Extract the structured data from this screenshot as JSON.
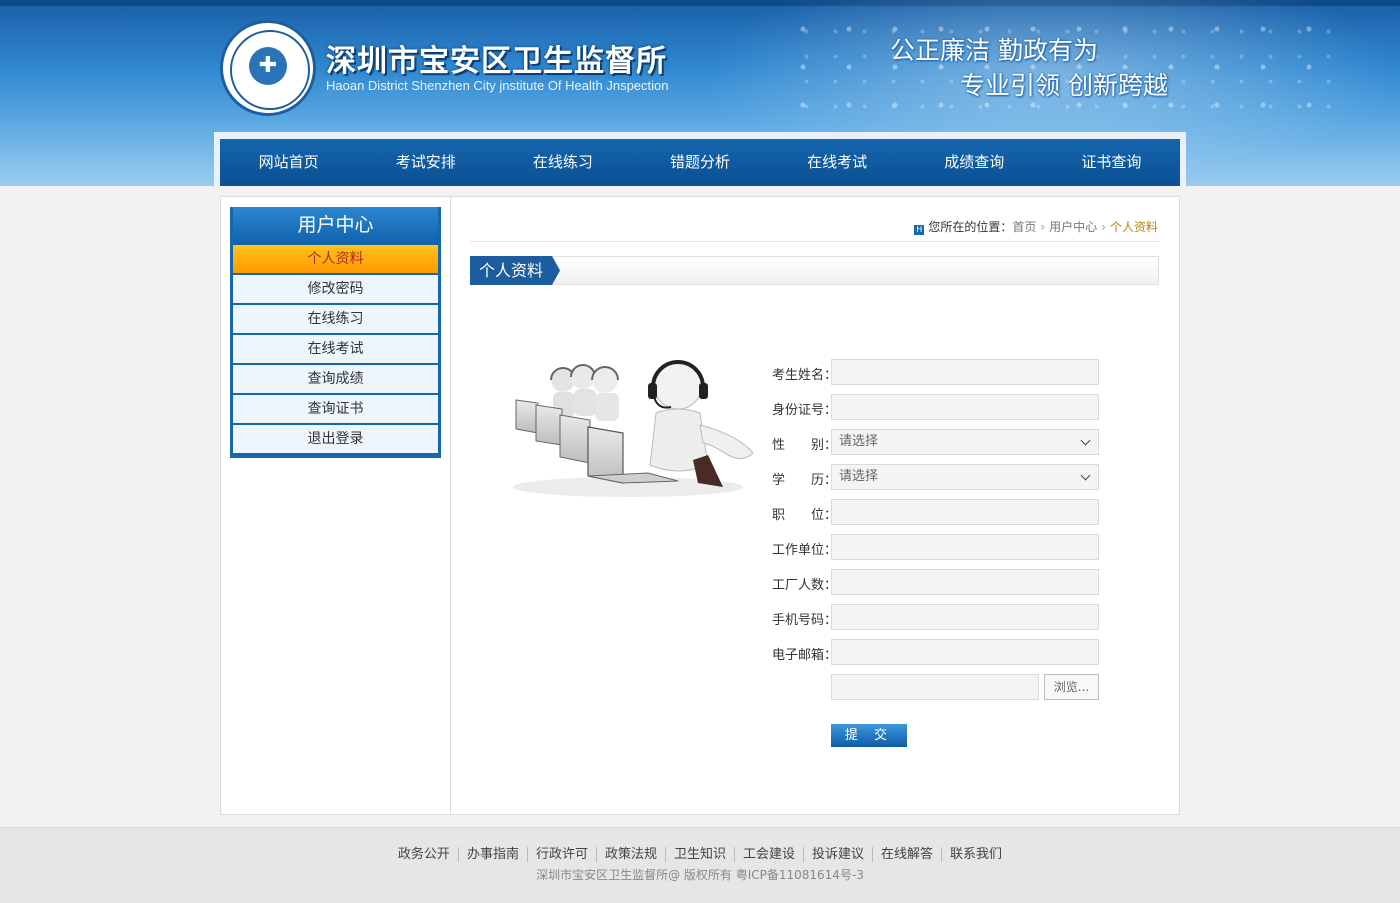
{
  "header": {
    "title": "深圳市宝安区卫生监督所",
    "subtitle": "Haoan District Shenzhen City jnstitute Of Health Jnspection",
    "emblem_text": "CHINA NATIONAL HEALTH INSPECTION 中国卫生监督",
    "slogan_line1": "公正廉洁  勤政有为",
    "slogan_line2": "专业引领  创新跨越"
  },
  "nav": {
    "items": [
      {
        "label": "网站首页"
      },
      {
        "label": "考试安排"
      },
      {
        "label": "在线练习"
      },
      {
        "label": "错题分析"
      },
      {
        "label": "在线考试"
      },
      {
        "label": "成绩查询"
      },
      {
        "label": "证书查询"
      }
    ]
  },
  "sidebar": {
    "title": "用户中心",
    "items": [
      {
        "label": "个人资料",
        "active": true
      },
      {
        "label": "修改密码"
      },
      {
        "label": "在线练习"
      },
      {
        "label": "在线考试"
      },
      {
        "label": "查询成绩"
      },
      {
        "label": "查询证书"
      },
      {
        "label": "退出登录"
      }
    ]
  },
  "breadcrumb": {
    "prefix": "您所在的位置：",
    "home": "首页",
    "parent": "用户中心",
    "current": "个人资料"
  },
  "section": {
    "title": "个人资料"
  },
  "form": {
    "fields": [
      {
        "label": "考生姓名：",
        "value": ""
      },
      {
        "label": "身份证号：",
        "value": ""
      },
      {
        "label": "性　　别：",
        "select": "请选择"
      },
      {
        "label": "学　　历：",
        "select": "请选择"
      },
      {
        "label": "职　　位：",
        "value": ""
      },
      {
        "label": "工作单位：",
        "value": ""
      },
      {
        "label": "工厂人数：",
        "value": ""
      },
      {
        "label": "手机号码：",
        "value": ""
      },
      {
        "label": "电子邮箱：",
        "value": ""
      }
    ],
    "browse_label": "浏览...",
    "submit_label": "提 交"
  },
  "footer": {
    "links": [
      "政务公开",
      "办事指南",
      "行政许可",
      "政策法规",
      "卫生知识",
      "工会建设",
      "投诉建议",
      "在线解答",
      "联系我们"
    ],
    "copyright": "深圳市宝安区卫生监督所@ 版权所有   粤ICP备11081614号-3"
  },
  "colors": {
    "nav_bg": "#0b4f93",
    "sidebar_bg": "#1767ae",
    "active_item": "#ff9a00",
    "crumb_current": "#b8860b"
  }
}
